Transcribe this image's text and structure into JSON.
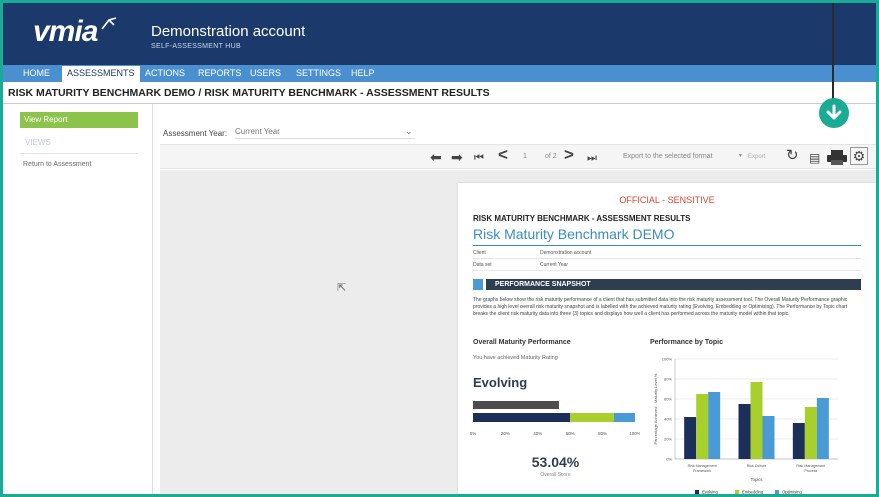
{
  "app": {
    "logo": "vmia",
    "account": "Demonstration account",
    "hub": "SELF-ASSESSMENT HUB"
  },
  "nav": [
    "HOME",
    "ASSESSMENTS",
    "ACTIONS",
    "REPORTS",
    "USERS",
    "SETTINGS",
    "HELP"
  ],
  "breadcrumb": "RISK MATURITY BENCHMARK DEMO / RISK MATURITY BENCHMARK - ASSESSMENT RESULTS",
  "sidebar": {
    "view_report": "View Report",
    "views": "VIEWS",
    "return": "Return to Assessment"
  },
  "filter": {
    "label": "Assessment Year:",
    "value": "Current Year"
  },
  "toolbar": {
    "page": "1",
    "of": "of 2",
    "export_select": "Export to the selected format",
    "export": "Export"
  },
  "report": {
    "classification": "OFFICIAL - SENSITIVE",
    "title": "RISK MATURITY BENCHMARK - ASSESSMENT RESULTS",
    "name": "Risk Maturity Benchmark DEMO",
    "fields": [
      {
        "k": "Client",
        "v": "Demonstration account"
      },
      {
        "k": "Data set",
        "v": "Current Year"
      }
    ],
    "section": "PERFORMANCE SNAPSHOT",
    "description": "The graphs below show the risk maturity performance of a client that has submitted data into the risk maturity assessment tool. The Overall Maturity Performance graphic provides a high level overall risk maturity snapshot and is labelled with the achieved maturity rating (Evolving, Embedding or Optimising). The Performance by Topic chart breaks the client risk maturity data into three (3) topics and displays how well a client has performed across the maturity model within that topic.",
    "overall_title": "Overall Maturity Performance",
    "achieved": "You have achieved Maturity Rating",
    "rating": "Evolving",
    "score": "53.04%",
    "score_label": "Overall Score",
    "topic_title": "Performance by Topic"
  },
  "colors": {
    "evolving": "#1b2f5a",
    "embedding": "#a8cf2c",
    "optimising": "#4a9ad6",
    "accent": "#1aab94"
  },
  "chart_data": [
    {
      "type": "bar",
      "orientation": "horizontal",
      "title": "Overall Maturity Performance",
      "xlim": [
        0,
        100
      ],
      "ticks": [
        "0%",
        "20%",
        "40%",
        "60%",
        "80%",
        "100%"
      ],
      "bars": [
        {
          "name": "score",
          "value": 53.04,
          "color": "#4d4d4d"
        },
        {
          "name": "scale",
          "segments": [
            {
              "name": "Evolving",
              "from": 0,
              "to": 60
            },
            {
              "name": "Embedding",
              "from": 60,
              "to": 87
            },
            {
              "name": "Optimising",
              "from": 87,
              "to": 100
            }
          ]
        }
      ]
    },
    {
      "type": "bar",
      "title": "Performance by Topic",
      "categories": [
        "Risk Management Framework",
        "Risk Culture",
        "Risk Management Process"
      ],
      "series": [
        {
          "name": "Evolving",
          "values": [
            42,
            55,
            36
          ]
        },
        {
          "name": "Embedding",
          "values": [
            65,
            77,
            52
          ]
        },
        {
          "name": "Optimising",
          "values": [
            67,
            43,
            61
          ]
        }
      ],
      "xlabel": "Topics",
      "ylabel": "Percentage Achieved - Maturity Level %",
      "ylim": [
        0,
        100
      ],
      "yticks": [
        "0%",
        "20%",
        "40%",
        "60%",
        "80%",
        "100%"
      ],
      "legend": "bottom"
    }
  ]
}
